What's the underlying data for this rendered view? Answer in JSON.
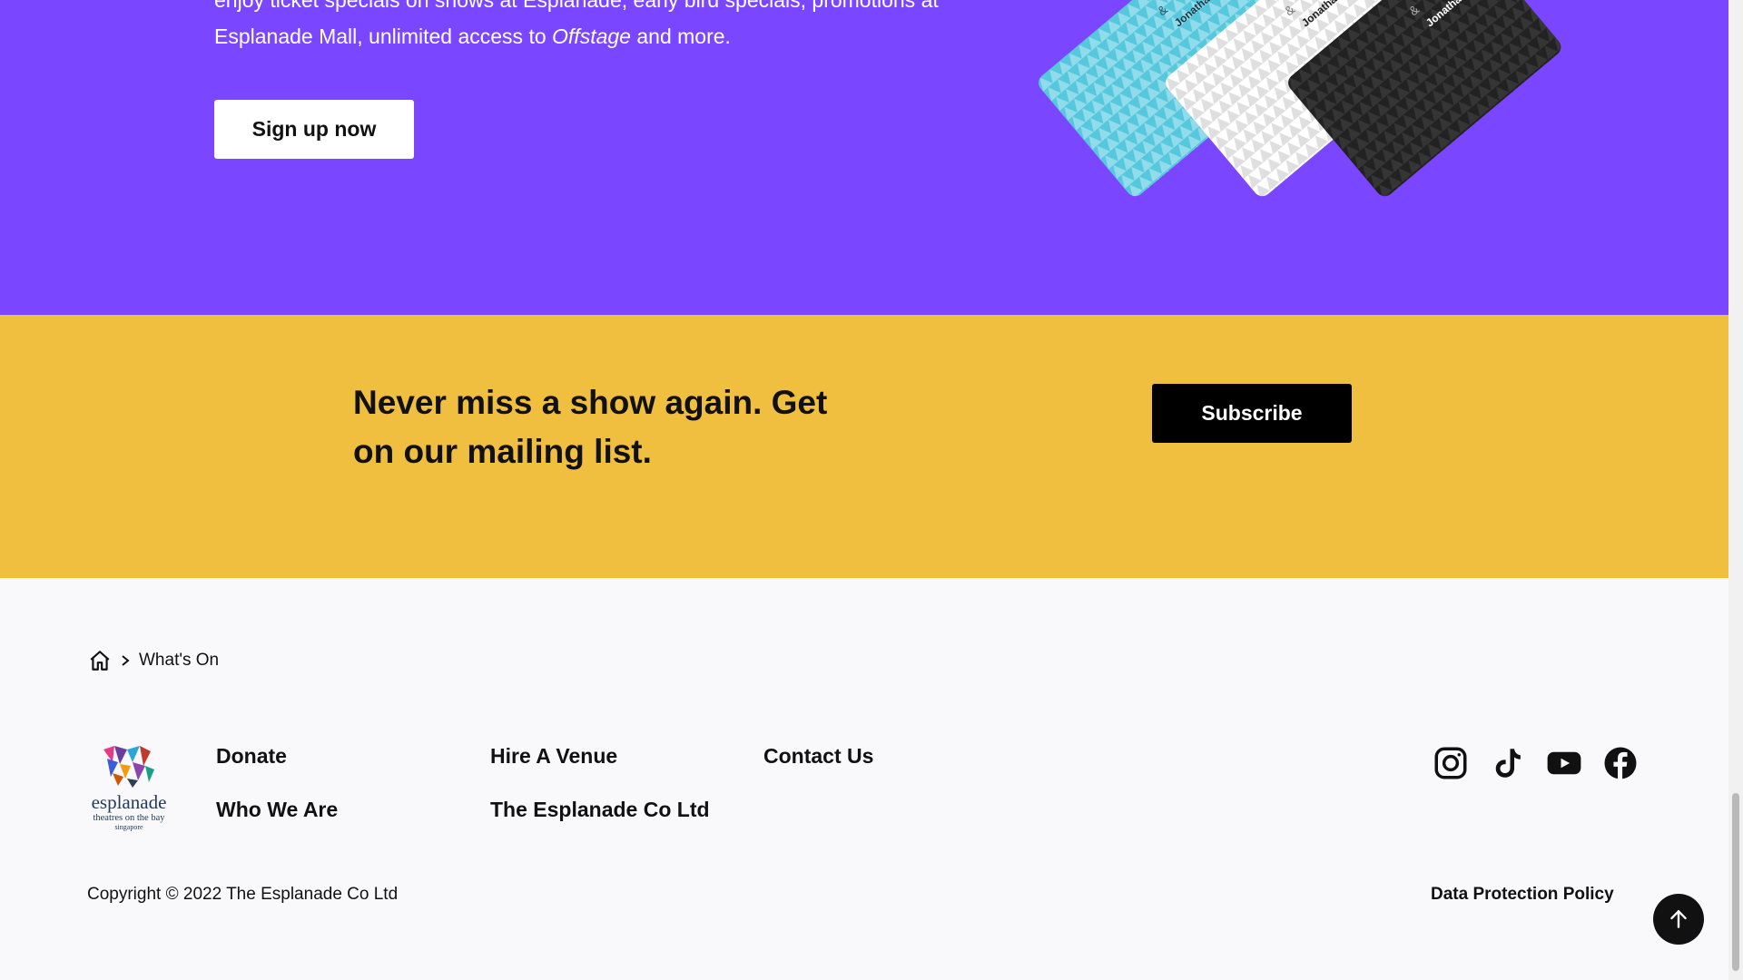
{
  "promo": {
    "line1": "enjoy ticket specials on shows at Esplanade, early bird specials, promotions at",
    "line2_before": "Esplanade Mall, unlimited access to ",
    "line2_italic": "Offstage",
    "line2_after": " and more.",
    "signup_label": "Sign up now",
    "card_text_amp": "&",
    "card_text_name": "Jonathan",
    "card_colors": [
      "#56c8de",
      "#ffffff",
      "#222222"
    ]
  },
  "mailing": {
    "title": "Never miss a show again. Get on our mailing list.",
    "subscribe_label": "Subscribe",
    "background": "#f1bf40"
  },
  "breadcrumb": {
    "home_icon": "home-icon",
    "separator_icon": "chevron-right-icon",
    "current": "What's On"
  },
  "footer": {
    "logo_word": "esplanade",
    "logo_sub1": "theatres on the bay",
    "logo_sub2": "singapore",
    "links": {
      "donate": "Donate",
      "who_we_are": "Who We Are",
      "hire_a_venue": "Hire A Venue",
      "esplanade_co": "The Esplanade Co Ltd",
      "contact_us": "Contact Us"
    },
    "social_icons": [
      "instagram-icon",
      "tiktok-icon",
      "youtube-icon",
      "facebook-icon"
    ],
    "copyright": "Copyright © 2022 The Esplanade Co Ltd",
    "data_protection": "Data Protection Policy",
    "back_to_top_icon": "arrow-up-icon"
  },
  "colors": {
    "promo_bg": "#7b46ff",
    "mailing_bg": "#f1bf40",
    "footer_bg": "#f9f9fc"
  }
}
